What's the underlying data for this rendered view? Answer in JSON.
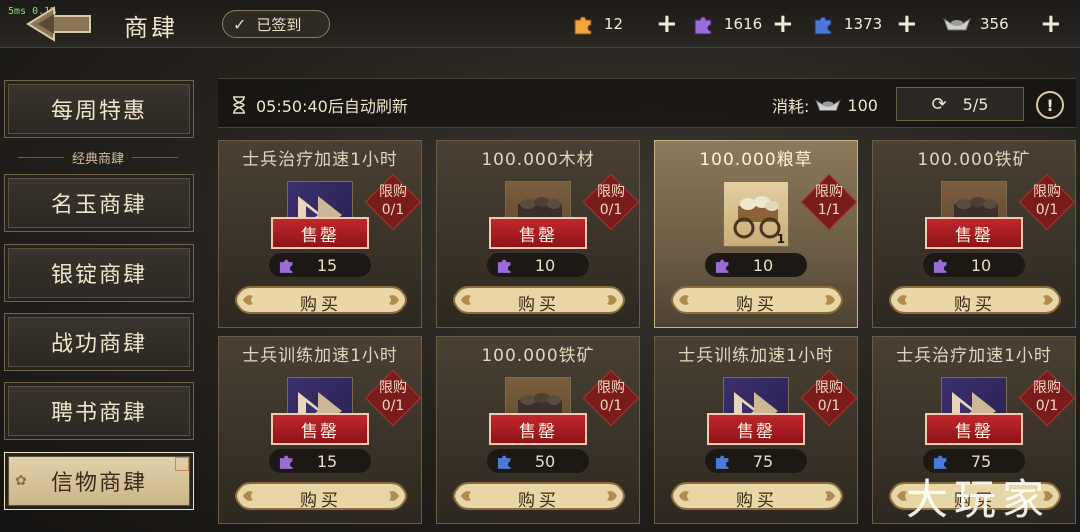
{
  "fps": "5ms 0.1%",
  "header": {
    "title": "商肆",
    "signin_label": "已签到"
  },
  "resources": [
    {
      "name": "orange-puzzle",
      "value": "12",
      "color": "#f0a640"
    },
    {
      "name": "purple-puzzle",
      "value": "1616",
      "color": "#9b6bd6"
    },
    {
      "name": "blue-puzzle",
      "value": "1373",
      "color": "#4a7ad6"
    },
    {
      "name": "silver-ingot",
      "value": "356",
      "color": "#c9c9c9"
    }
  ],
  "sidebar": {
    "items": [
      {
        "label": "每周特惠"
      },
      {
        "label": "名玉商肆"
      },
      {
        "label": "银锭商肆"
      },
      {
        "label": "战功商肆"
      },
      {
        "label": "聘书商肆"
      },
      {
        "label": "信物商肆"
      }
    ],
    "section_label": "经典商肆",
    "active": "信物商肆"
  },
  "info": {
    "refresh_text": "05:50:40后自动刷新",
    "cost_label": "消耗:",
    "cost_value": "100",
    "refresh_count": "5/5",
    "help": "!"
  },
  "cards": [
    {
      "title": "士兵治疗加速1小时",
      "item": "speed",
      "limit_label": "限购",
      "limit": "0/1",
      "sold_out": "售罄",
      "price_icon": "purple-puzzle",
      "price": "15",
      "buy": "购买",
      "highlight": false,
      "qty": ""
    },
    {
      "title": "100.000木材",
      "item": "goods",
      "limit_label": "限购",
      "limit": "0/1",
      "sold_out": "售罄",
      "price_icon": "purple-puzzle",
      "price": "10",
      "buy": "购买",
      "highlight": false,
      "qty": ""
    },
    {
      "title": "100.000粮草",
      "item": "grain",
      "limit_label": "限购",
      "limit": "1/1",
      "sold_out": "",
      "price_icon": "purple-puzzle",
      "price": "10",
      "buy": "购买",
      "highlight": true,
      "qty": "1"
    },
    {
      "title": "100.000铁矿",
      "item": "goods",
      "limit_label": "限购",
      "limit": "0/1",
      "sold_out": "售罄",
      "price_icon": "purple-puzzle",
      "price": "10",
      "buy": "购买",
      "highlight": false,
      "qty": ""
    },
    {
      "title": "士兵训练加速1小时",
      "item": "speed",
      "limit_label": "限购",
      "limit": "0/1",
      "sold_out": "售罄",
      "price_icon": "purple-puzzle",
      "price": "15",
      "buy": "购买",
      "highlight": false,
      "qty": ""
    },
    {
      "title": "100.000铁矿",
      "item": "goods",
      "limit_label": "限购",
      "limit": "0/1",
      "sold_out": "售罄",
      "price_icon": "blue-puzzle",
      "price": "50",
      "buy": "购买",
      "highlight": false,
      "qty": ""
    },
    {
      "title": "士兵训练加速1小时",
      "item": "speed",
      "limit_label": "限购",
      "limit": "0/1",
      "sold_out": "售罄",
      "price_icon": "blue-puzzle",
      "price": "75",
      "buy": "购买",
      "highlight": false,
      "qty": ""
    },
    {
      "title": "士兵治疗加速1小时",
      "item": "speed",
      "limit_label": "限购",
      "limit": "0/1",
      "sold_out": "售罄",
      "price_icon": "blue-puzzle",
      "price": "75",
      "buy": "购买",
      "highlight": false,
      "qty": ""
    }
  ],
  "watermark": "大玩家"
}
